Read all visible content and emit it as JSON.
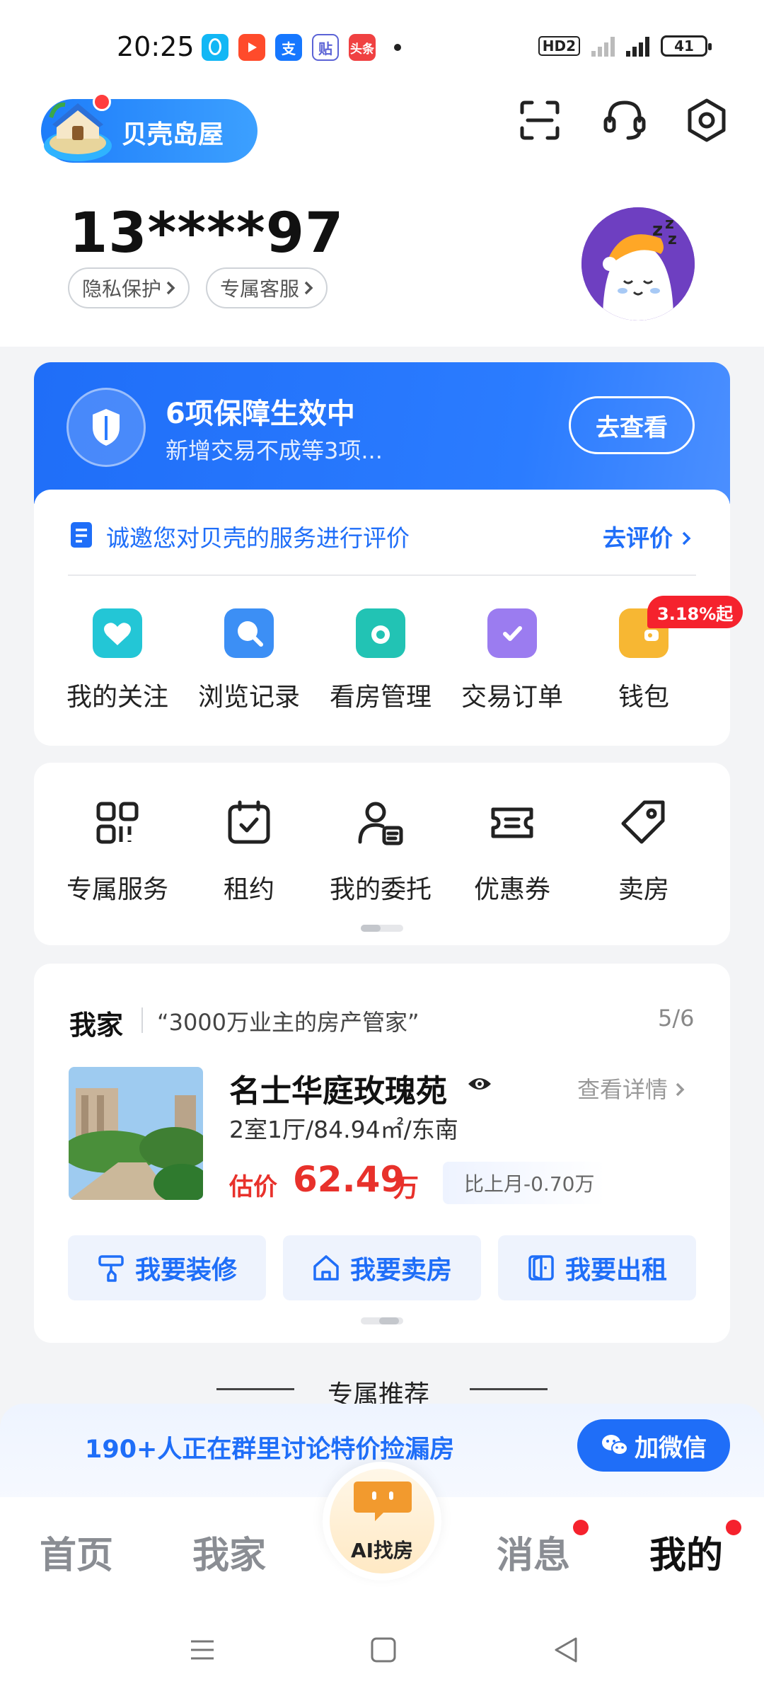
{
  "status_bar": {
    "time": "20:25",
    "hd": "HD2",
    "network": "5G",
    "battery": "41"
  },
  "header": {
    "brand": "贝壳岛屋",
    "phone": "13****97",
    "privacy": "隐私保护",
    "service": "专属客服"
  },
  "guarantee": {
    "title": "6项保障生效中",
    "subtitle": "新增交易不成等3项...",
    "button": "去查看"
  },
  "review": {
    "text": "诚邀您对贝壳的服务进行评价",
    "link": "去评价"
  },
  "services": [
    {
      "label": "我的关注",
      "icon": "heart-icon",
      "color": "#23c6d6"
    },
    {
      "label": "浏览记录",
      "icon": "search-icon",
      "color": "#3c8ff5"
    },
    {
      "label": "看房管理",
      "icon": "camera-icon",
      "color": "#22c3b4"
    },
    {
      "label": "交易订单",
      "icon": "clipboard-check-icon",
      "color": "#9b7cf0"
    },
    {
      "label": "钱包",
      "icon": "wallet-icon",
      "color": "#f7b733"
    }
  ],
  "wallet_badge": "3.18%起",
  "tools": [
    {
      "label": "专属服务",
      "icon": "grid-icon"
    },
    {
      "label": "租约",
      "icon": "calendar-check-icon"
    },
    {
      "label": "我的委托",
      "icon": "user-card-icon"
    },
    {
      "label": "优惠券",
      "icon": "ticket-icon"
    },
    {
      "label": "卖房",
      "icon": "tag-icon"
    }
  ],
  "home": {
    "title": "我家",
    "slogan": "“3000万业主的房产管家”",
    "page": "5/6",
    "name": "名士华庭玫瑰苑",
    "detail_link": "查看详情",
    "spec": "2室1厅/84.94㎡/东南",
    "price_label": "估价",
    "price": "62.49",
    "price_unit": "万",
    "delta": "比上月-0.70万",
    "actions": [
      {
        "label": "我要装修",
        "icon": "paint-roller-icon"
      },
      {
        "label": "我要卖房",
        "icon": "home-icon"
      },
      {
        "label": "我要出租",
        "icon": "door-icon"
      }
    ]
  },
  "recommend": {
    "title": "专属推荐"
  },
  "wechat_banner": {
    "text": "190+人正在群里讨论特价捡漏房",
    "button": "加微信"
  },
  "bottom_nav": {
    "items": [
      "首页",
      "我家",
      "AI找房",
      "消息",
      "我的"
    ],
    "active": "我的"
  },
  "colors": {
    "primary": "#1f6ef8",
    "price": "#e8312b",
    "badge": "#f5222d"
  }
}
